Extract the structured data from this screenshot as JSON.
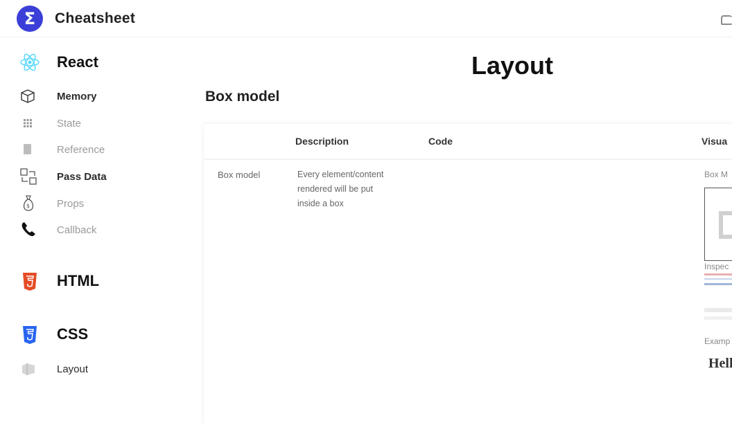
{
  "header": {
    "logo_glyph": "Σ",
    "app_title": "Cheatsheet"
  },
  "sidebar": {
    "sections": [
      {
        "label": "React",
        "items": [
          {
            "label": "Memory"
          },
          {
            "label": "State"
          },
          {
            "label": "Reference"
          },
          {
            "label": "Pass Data"
          },
          {
            "label": "Props"
          },
          {
            "label": "Callback"
          }
        ]
      },
      {
        "label": "HTML",
        "items": []
      },
      {
        "label": "CSS",
        "items": [
          {
            "label": "Layout"
          }
        ]
      }
    ]
  },
  "main": {
    "page_title": "Layout",
    "section_title": "Box model",
    "table": {
      "headers": [
        "Description",
        "Code",
        "Visua"
      ],
      "rows": [
        {
          "name": "Box model",
          "description_lines": [
            "Every element/content",
            "rendered will be put",
            "inside a box"
          ],
          "visual": {
            "caption_top": "Box M",
            "caption_mid": "Inspec",
            "caption_low": "Examp",
            "example_text": "Hell"
          }
        }
      ]
    }
  },
  "colors": {
    "accent": "#3b3fd8",
    "react": "#61dafb",
    "html": "#e44d26",
    "css": "#2965f1"
  }
}
